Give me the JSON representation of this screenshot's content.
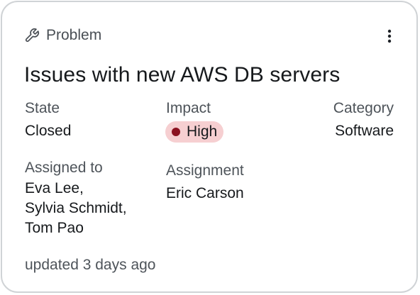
{
  "card": {
    "type_label": "Problem",
    "type_icon": "wrench-icon",
    "menu_icon": "more-vertical-icon",
    "title": "Issues with new AWS DB servers",
    "fields": {
      "state": {
        "label": "State",
        "value": "Closed"
      },
      "impact": {
        "label": "Impact",
        "value": "High",
        "badge_bg": "#f6cfd1",
        "dot_color": "#8b1120"
      },
      "category": {
        "label": "Category",
        "value": "Software"
      },
      "assigned_to": {
        "label": "Assigned to",
        "names": [
          "Eva Lee,",
          "Sylvia Schmidt,",
          "Tom Pao"
        ]
      },
      "assignment": {
        "label": "Assignment",
        "value": "Eric Carson"
      }
    },
    "updated": "updated 3 days ago"
  }
}
